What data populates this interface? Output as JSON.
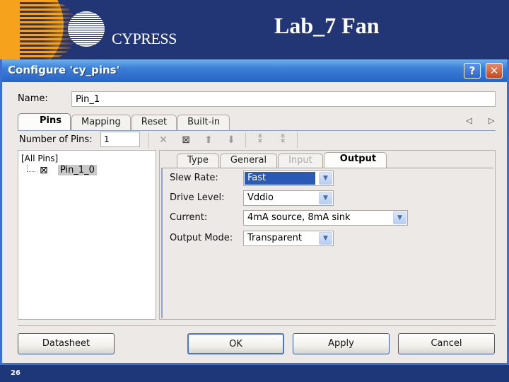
{
  "slide": {
    "title": "Lab_7 Fan",
    "logo_text": "CYPRESS",
    "page_number": "26"
  },
  "dialog": {
    "title": "Configure 'cy_pins'",
    "help_glyph": "?",
    "close_glyph": "✕",
    "name_label": "Name:",
    "name_value": "Pin_1",
    "tabs": [
      {
        "label": "Pins",
        "active": true
      },
      {
        "label": "Mapping"
      },
      {
        "label": "Reset"
      },
      {
        "label": "Built-in"
      }
    ],
    "tab_scroll": "◁ ▷",
    "number_of_pins_label": "Number of Pins:",
    "number_of_pins_value": "1",
    "toolbar": [
      {
        "name": "delete-icon",
        "glyph": "✕"
      },
      {
        "name": "pin-box-icon",
        "glyph": "⊠"
      },
      {
        "name": "move-up-icon",
        "glyph": "⬆"
      },
      {
        "name": "move-down-icon",
        "glyph": "⬇"
      },
      {
        "name": "group-pins-icon",
        "glyph": "⁑"
      },
      {
        "name": "ungroup-pins-icon",
        "glyph": "⁑"
      }
    ],
    "tree": {
      "root": "[All Pins]",
      "item_glyph": "⊠",
      "item": "Pin_1_0"
    },
    "subtabs": [
      {
        "label": "Type"
      },
      {
        "label": "General"
      },
      {
        "label": "Input",
        "disabled": true
      },
      {
        "label": "Output",
        "active": true
      }
    ],
    "properties": [
      {
        "label": "Slew Rate:",
        "value": "Fast"
      },
      {
        "label": "Drive Level:",
        "value": "Vddio"
      },
      {
        "label": "Current:",
        "value": "4mA source, 8mA sink"
      },
      {
        "label": "Output Mode:",
        "value": "Transparent"
      }
    ],
    "combo_glyph": "▼",
    "buttons": {
      "datasheet": "Datasheet",
      "ok": "OK",
      "apply": "Apply",
      "cancel": "Cancel"
    }
  }
}
